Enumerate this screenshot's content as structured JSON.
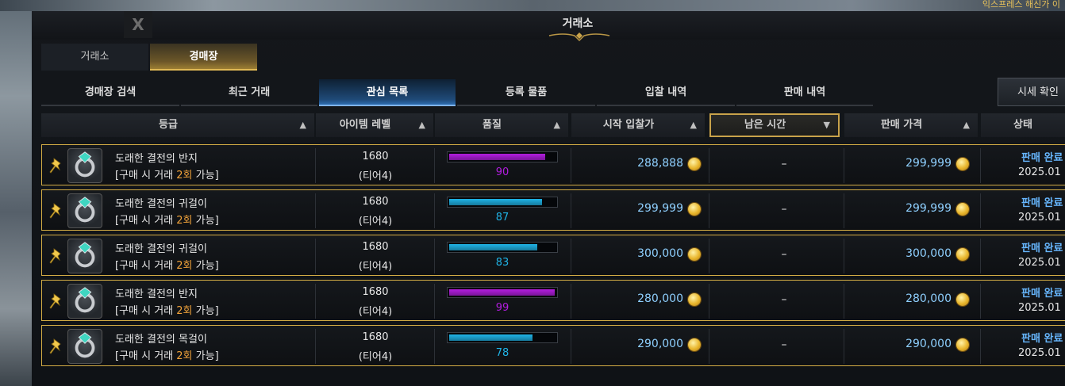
{
  "window": {
    "title": "거래소",
    "close_label": "X"
  },
  "top_notice": "익스프레스 해신가 이",
  "main_tabs": [
    {
      "label": "거래소"
    },
    {
      "label": "경매장"
    }
  ],
  "sub_tabs": [
    {
      "label": "경매장 검색"
    },
    {
      "label": "최근 거래"
    },
    {
      "label": "관심 목록"
    },
    {
      "label": "등록 물품"
    },
    {
      "label": "입찰 내역"
    },
    {
      "label": "판매 내역"
    }
  ],
  "price_check_button": "시세 확인",
  "columns": [
    {
      "label": "등급",
      "arrow": "▲"
    },
    {
      "label": "아이템 레벨",
      "arrow": "▲"
    },
    {
      "label": "품질",
      "arrow": "▲"
    },
    {
      "label": "시작 입찰가",
      "arrow": "▲"
    },
    {
      "label": "남은 시간",
      "arrow": "▼"
    },
    {
      "label": "판매 가격",
      "arrow": "▲"
    },
    {
      "label": "상태",
      "arrow": ""
    }
  ],
  "rows": [
    {
      "name": "도래한 결전의 반지",
      "note_pre": "[구매 시 거래 ",
      "note_hl": "2회",
      "note_post": " 가능]",
      "level": "1680",
      "tier": "(티어4)",
      "quality": "90",
      "quality_color": "#b31de0",
      "start_bid": "288,888",
      "remaining": "–",
      "sell_price": "299,999",
      "status": "판매 완료",
      "date": "2025.01"
    },
    {
      "name": "도래한 결전의 귀걸이",
      "note_pre": "[구매 시 거래 ",
      "note_hl": "2회",
      "note_post": " 가능]",
      "level": "1680",
      "tier": "(티어4)",
      "quality": "87",
      "quality_color": "#1fb3e6",
      "start_bid": "299,999",
      "remaining": "–",
      "sell_price": "299,999",
      "status": "판매 완료",
      "date": "2025.01"
    },
    {
      "name": "도래한 결전의 귀걸이",
      "note_pre": "[구매 시 거래 ",
      "note_hl": "2회",
      "note_post": " 가능]",
      "level": "1680",
      "tier": "(티어4)",
      "quality": "83",
      "quality_color": "#1fb3e6",
      "start_bid": "300,000",
      "remaining": "–",
      "sell_price": "300,000",
      "status": "판매 완료",
      "date": "2025.01"
    },
    {
      "name": "도래한 결전의 반지",
      "note_pre": "[구매 시 거래 ",
      "note_hl": "2회",
      "note_post": " 가능]",
      "level": "1680",
      "tier": "(티어4)",
      "quality": "99",
      "quality_color": "#b31de0",
      "start_bid": "280,000",
      "remaining": "–",
      "sell_price": "280,000",
      "status": "판매 완료",
      "date": "2025.01"
    },
    {
      "name": "도래한 결전의 목걸이",
      "note_pre": "[구매 시 거래 ",
      "note_hl": "2회",
      "note_post": " 가능]",
      "level": "1680",
      "tier": "(티어4)",
      "quality": "78",
      "quality_color": "#1fb3e6",
      "start_bid": "290,000",
      "remaining": "–",
      "sell_price": "290,000",
      "status": "판매 완료",
      "date": "2025.01"
    }
  ]
}
